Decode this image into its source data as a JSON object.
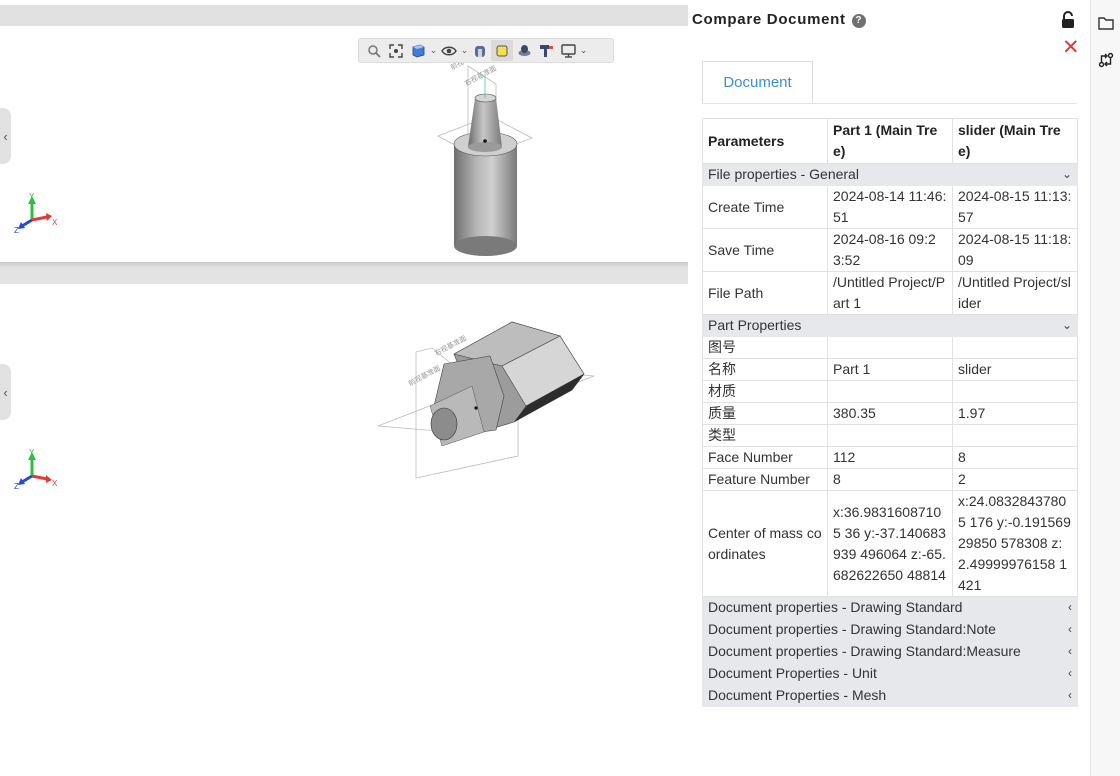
{
  "panel": {
    "title": "Compare Document",
    "tab_label": "Document",
    "headers": [
      "Parameters",
      "Part 1 (Main Tree)",
      "slider (Main Tree)"
    ],
    "sections": [
      {
        "title": "File properties - General",
        "expanded": true,
        "rows": [
          [
            "Create Time",
            "2024-08-14 11:46:51",
            "2024-08-15 11:13:57"
          ],
          [
            "Save Time",
            "2024-08-16 09:23:52",
            "2024-08-15 11:18:09"
          ],
          [
            "File Path",
            "/Untitled Project/Part 1",
            "/Untitled Project/slider"
          ]
        ]
      },
      {
        "title": "Part Properties",
        "expanded": true,
        "rows": [
          [
            "图号",
            "",
            ""
          ],
          [
            "名称",
            "Part 1",
            "slider"
          ],
          [
            "材质",
            "",
            ""
          ],
          [
            "质量",
            "380.35",
            "1.97"
          ],
          [
            "类型",
            "",
            ""
          ],
          [
            "Face Number",
            "112",
            "8"
          ],
          [
            "Feature Number",
            "8",
            "2"
          ],
          [
            "Center of mass coordinates",
            "x:36.98316087105 36 y:-37.140683939 496064 z:-65.682622650 48814",
            "x:24.08328437805 176 y:-0.19156929850 578308 z:2.49999976158 1421"
          ]
        ]
      },
      {
        "title": "Document properties - Drawing Standard",
        "expanded": false,
        "rows": []
      },
      {
        "title": "Document properties - Drawing Standard:Note",
        "expanded": false,
        "rows": []
      },
      {
        "title": "Document properties - Drawing Standard:Measure",
        "expanded": false,
        "rows": []
      },
      {
        "title": "Document Properties - Unit",
        "expanded": false,
        "rows": []
      },
      {
        "title": "Document Properties - Mesh",
        "expanded": false,
        "rows": []
      }
    ]
  },
  "viewport": {
    "toolbar_icons": [
      "zoom-icon",
      "fit-view-icon",
      "view-cube-icon",
      "visibility-eye-icon",
      "section-view-icon",
      "shaded-display-icon",
      "render-mode-icon",
      "appearance-icon",
      "display-settings-icon"
    ],
    "axis_labels": {
      "x": "X",
      "y": "Y",
      "z": "Z"
    },
    "plane_labels": [
      "前视基准面",
      "右视基准面"
    ]
  },
  "icons": {
    "lock": "unlock-icon",
    "close": "close-icon",
    "help": "help-icon",
    "rail": [
      "folder-icon",
      "compare-icon"
    ]
  },
  "colors": {
    "accent": "#3a8fd8",
    "close": "#e53935",
    "section_bg": "#e6e8ec",
    "axis_x": "#e53935",
    "axis_y": "#2fbf3c",
    "axis_z": "#1f4fd6"
  }
}
